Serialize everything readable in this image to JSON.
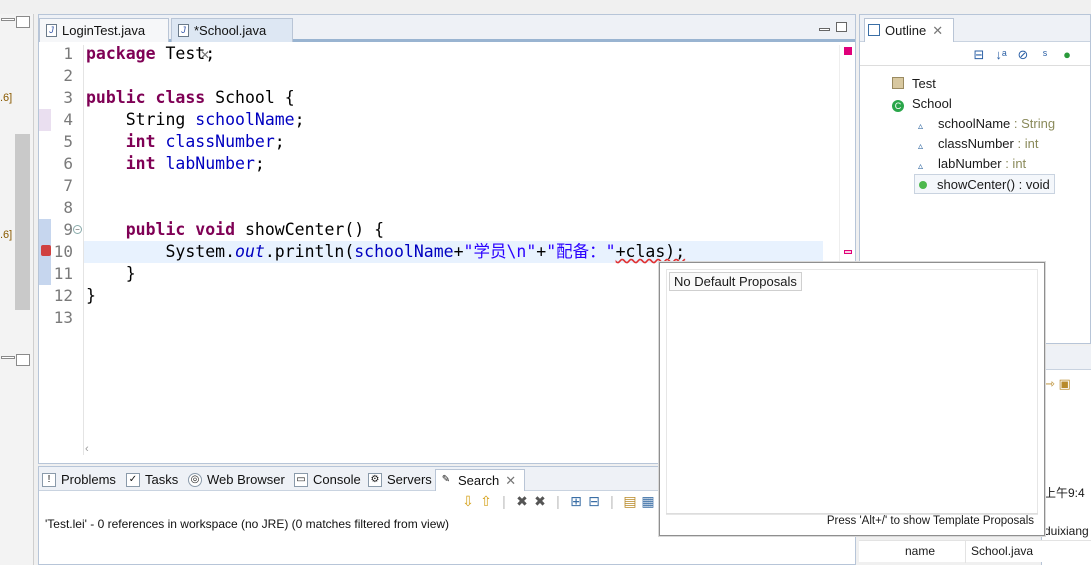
{
  "editor": {
    "tabs": [
      {
        "label": "LoginTest.java",
        "active": false
      },
      {
        "label": "*School.java",
        "active": true
      }
    ],
    "line_numbers": [
      "1",
      "2",
      "3",
      "4",
      "5",
      "6",
      "7",
      "8",
      "9",
      "10",
      "11",
      "12",
      "13"
    ],
    "code": {
      "l1_kw": "package",
      "l1_rest": " Test;",
      "l3_kw1": "public",
      "l3_kw2": "class",
      "l3_rest": " School {",
      "l4_type": "    String ",
      "l4_field": "schoolName",
      "l4_end": ";",
      "l5_kw": "int",
      "l5_field": "classNumber",
      "l5_end": ";",
      "l6_kw": "int",
      "l6_field": "labNumber",
      "l6_end": ";",
      "l9_kw1": "public",
      "l9_kw2": "void",
      "l9_rest": " showCenter() {",
      "l10_a": "System.",
      "l10_out": "out",
      "l10_b": ".println(",
      "l10_field": "schoolName",
      "l10_c": "+",
      "l10_str1": "\"学员\\n\"",
      "l10_d": "+",
      "l10_str2": "\"配备：\"",
      "l10_e": "+clas);",
      "l11": "    }",
      "l12": "}"
    }
  },
  "bottom_panel": {
    "tabs": [
      "Problems",
      "Tasks",
      "Web Browser",
      "Console",
      "Servers",
      "Search"
    ],
    "status": "'Test.lei' - 0 references in workspace (no JRE) (0 matches filtered from view)"
  },
  "outline": {
    "title": "Outline",
    "items": [
      {
        "name": "Test",
        "type": ""
      },
      {
        "name": "School",
        "type": ""
      },
      {
        "name": "schoolName",
        "type": " : String"
      },
      {
        "name": "classNumber",
        "type": " : int"
      },
      {
        "name": "labNumber",
        "type": " : int"
      },
      {
        "name": "showCenter() : void",
        "type": ""
      }
    ]
  },
  "left_strip": {
    "label1": ".6]",
    "label2": ".6]"
  },
  "properties": {
    "time": "上午9:4",
    "author": "duixiang",
    "name_label": "name",
    "name_value": "School.java"
  },
  "popup": {
    "message": "No Default Proposals",
    "hint": "Press 'Alt+/' to show Template Proposals"
  },
  "colors": {
    "keyword": "#7f0055",
    "field": "#0000c0",
    "string": "#2a00ff",
    "current_line": "#e8f2fe"
  }
}
